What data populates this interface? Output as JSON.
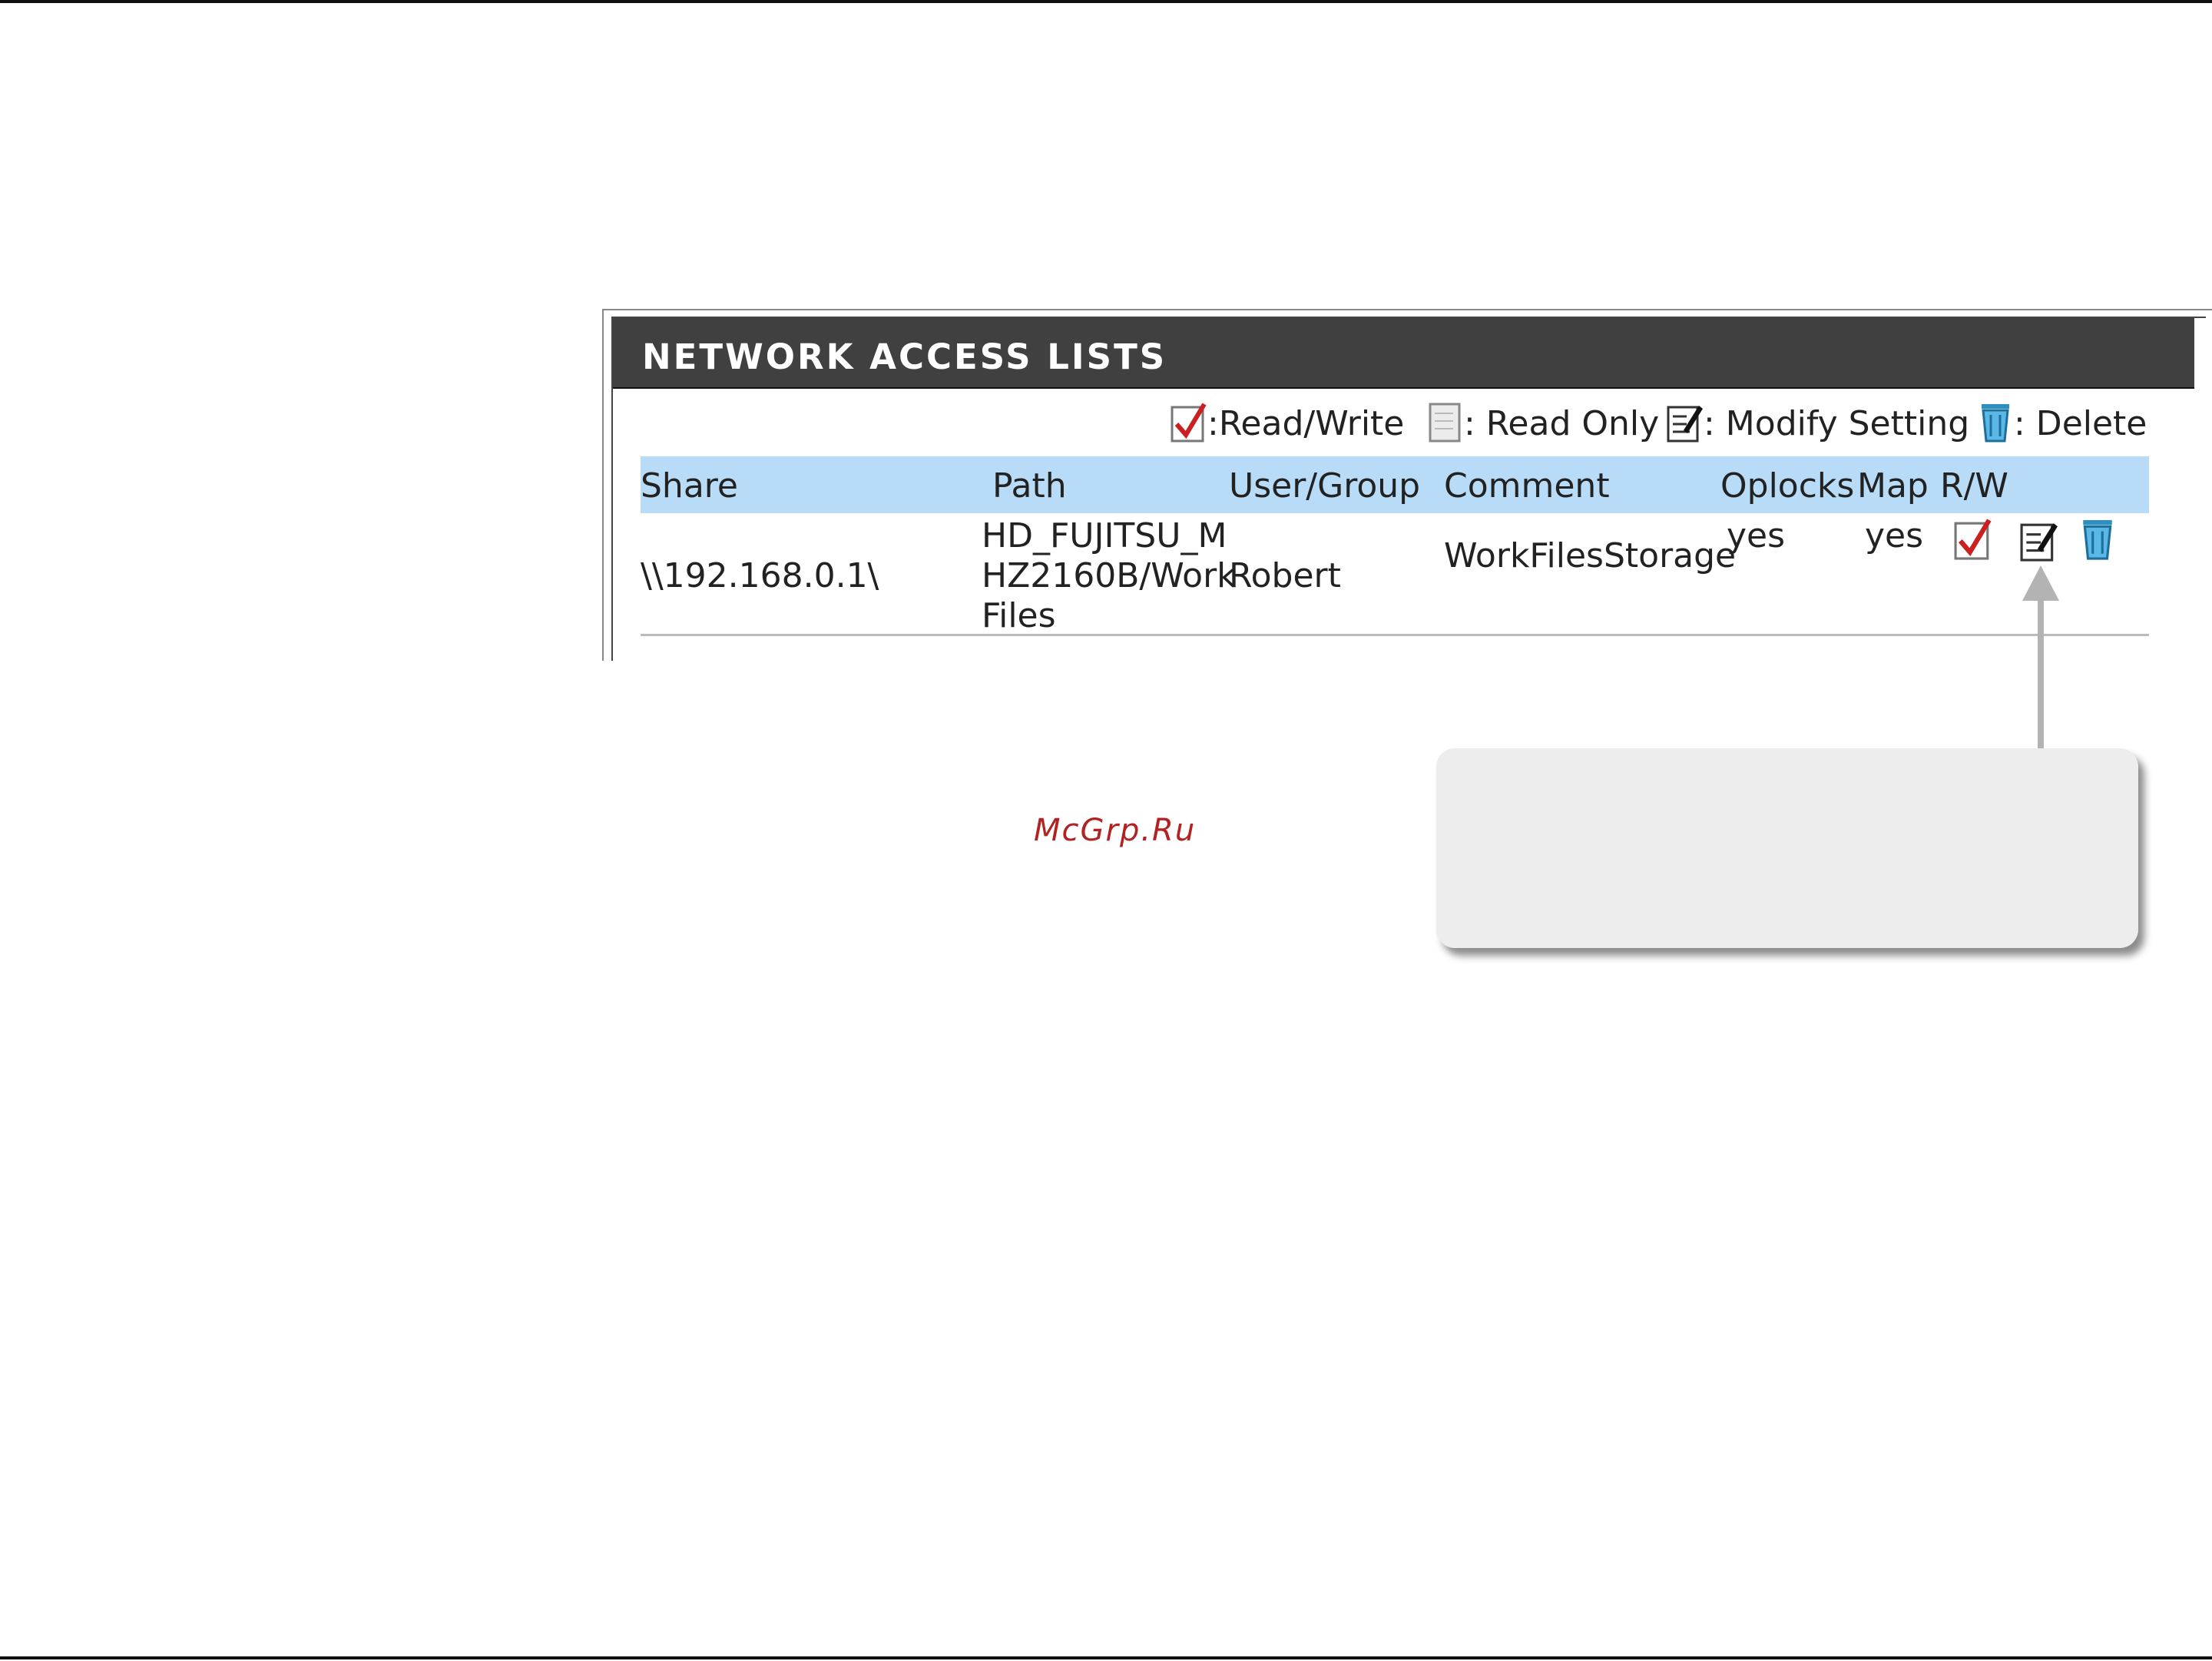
{
  "panel": {
    "title": "NETWORK ACCESS LISTS"
  },
  "legend": {
    "read_write": ":Read/Write",
    "read_only": ": Read Only",
    "modify": ": Modify Setting",
    "delete": ": Delete"
  },
  "table": {
    "headers": {
      "share": "Share",
      "path": "Path",
      "user_group": "User/Group",
      "comment": "Comment",
      "oplocks": "Oplocks",
      "map": "Map",
      "rw": "R/W"
    },
    "rows": [
      {
        "share": "\\\\192.168.0.1\\",
        "path_line1": "HD_FUJITSU_M",
        "path_line2": "HZ2160B/Work",
        "path_line3": "Files",
        "user_group": "Robert",
        "comment": "WorkFilesStorage",
        "oplocks": "yes",
        "map": "yes"
      }
    ]
  },
  "watermark": "McGrp.Ru",
  "icons": [
    "checkmark-icon",
    "page-icon",
    "edit-icon",
    "trash-icon"
  ],
  "colors": {
    "header_bg": "#404040",
    "table_header_bg": "#b8dcf7",
    "check_red": "#cc1f1f",
    "trash_blue": "#3aa3d6"
  }
}
